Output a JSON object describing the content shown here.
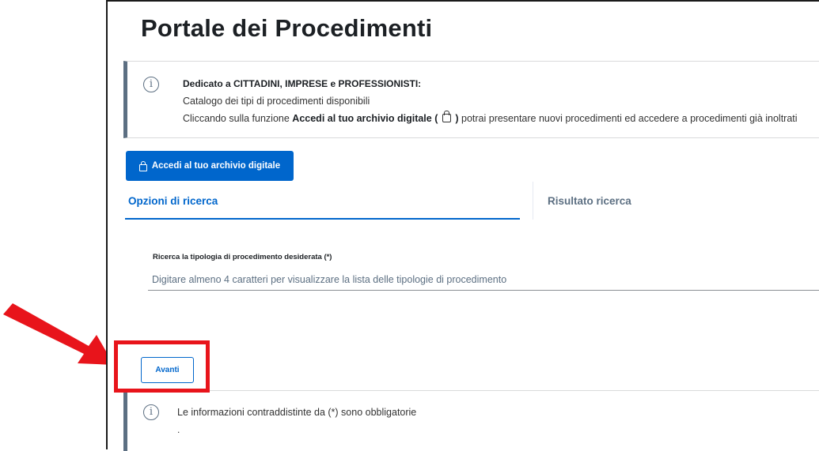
{
  "header": {
    "title": "Portale dei Procedimenti"
  },
  "info": {
    "line1": "Dedicato a CITTADINI, IMPRESE e PROFESSIONISTI:",
    "line2": "Catalogo dei tipi di procedimenti disponibili",
    "line3_prefix": "Cliccando sulla funzione",
    "line3_bold": "Accedi al tuo archivio digitale (",
    "line3_bold_close": ")",
    "line3_suffix": "potrai presentare nuovi procedimenti ed accedere a procedimenti già inoltrati",
    "icon": "info-circle-icon"
  },
  "access_button": {
    "label": "Accedi al tuo archivio digitale",
    "icon": "lock-icon",
    "color": "#0066cc"
  },
  "tabs": [
    {
      "label": "Opzioni di ricerca",
      "active": true
    },
    {
      "label": "Risultato ricerca",
      "active": false
    }
  ],
  "search": {
    "label": "Ricerca la tipologia di procedimento desiderata (*)",
    "placeholder": "Digitare almeno 4 caratteri per visualizzare la lista delle tipologie di procedimento",
    "value": ""
  },
  "next_button": {
    "label": "Avanti"
  },
  "bottom_note": {
    "text": "Le informazioni contraddistinte da (*) sono obbligatorie",
    "dot": ".",
    "icon": "info-circle-icon"
  },
  "annotation": {
    "arrow_color": "#e8141b",
    "box_color": "#e8141b"
  }
}
